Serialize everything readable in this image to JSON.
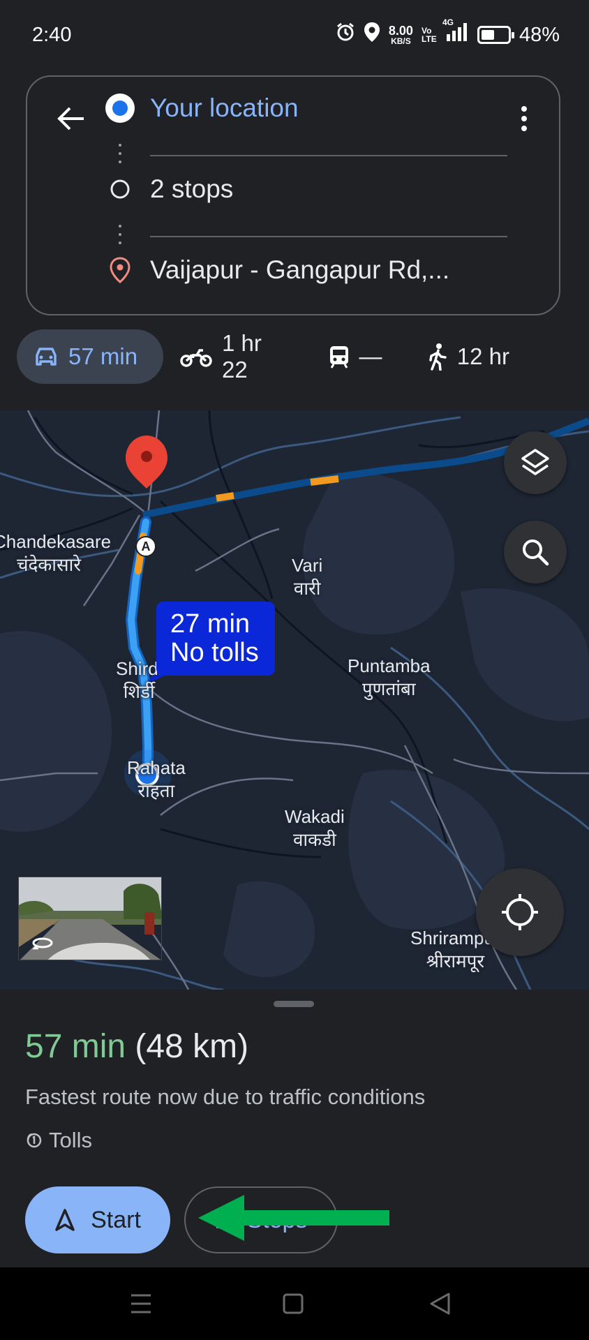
{
  "status_bar": {
    "time": "2:40",
    "net_speed": "8.00",
    "net_unit": "KB/S",
    "volte": "Vo LTE",
    "network": "4G",
    "battery": "48%",
    "battery_level": 0.48
  },
  "directions": {
    "origin": "Your location",
    "stops": "2 stops",
    "destination": "Vaijapur - Gangapur Rd,..."
  },
  "modes": [
    {
      "icon": "car-icon",
      "label": "57 min",
      "active": true
    },
    {
      "icon": "motorcycle-icon",
      "label": "1 hr 22",
      "active": false
    },
    {
      "icon": "transit-icon",
      "label": "—",
      "active": false
    },
    {
      "icon": "walk-icon",
      "label": "12 hr",
      "active": false
    }
  ],
  "map": {
    "places": [
      {
        "en": "Chandekasare",
        "local": "चंदेकासारे"
      },
      {
        "en": "Vari",
        "local": "वारी"
      },
      {
        "en": "Shirdi",
        "local": "शिर्डी"
      },
      {
        "en": "Puntamba",
        "local": "पुणतांबा"
      },
      {
        "en": "Rahata",
        "local": "राहता"
      },
      {
        "en": "Wakadi",
        "local": "वाकडी"
      },
      {
        "en": "Shrirampur",
        "local": "श्रीरामपूर"
      }
    ],
    "route_chip": {
      "line1": "27 min",
      "line2": "No tolls"
    },
    "pin_label": "A",
    "colors": {
      "route": "#3ca0f5",
      "traffic": "#f29a1f",
      "pin": "#ea4335"
    }
  },
  "sheet": {
    "eta_time": "57 min",
    "eta_distance": "(48 km)",
    "reason": "Fastest route now due to traffic conditions",
    "tolls": "Tolls",
    "start_label": "Start",
    "steps_label": "Steps"
  }
}
